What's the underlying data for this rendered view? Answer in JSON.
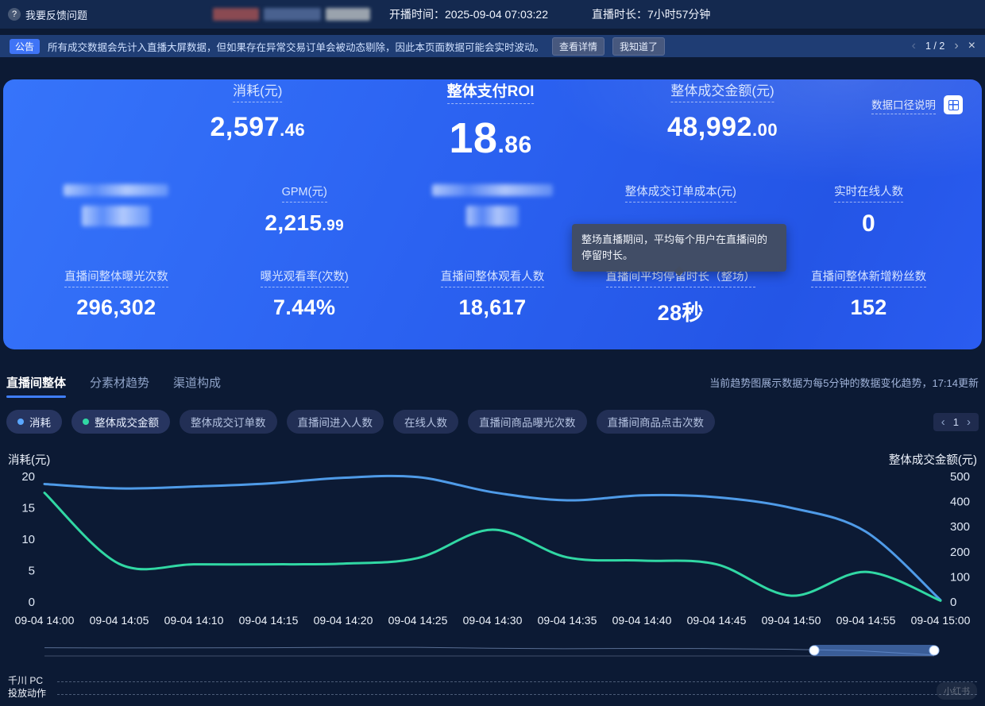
{
  "topbar": {
    "feedback_label": "我要反馈问题",
    "question_icon": "?",
    "start_time_label": "开播时间：",
    "start_time_value": "2025-09-04 07:03:22",
    "duration_label": "直播时长：",
    "duration_value": "7小时57分钟"
  },
  "announcement": {
    "badge": "公告",
    "message": "所有成交数据会先计入直播大屏数据，但如果存在异常交易订单会被动态剔除，因此本页面数据可能会实时波动。",
    "detail_button": "查看详情",
    "ack_button": "我知道了",
    "page_indicator": "1 / 2",
    "prev_icon": "‹",
    "next_icon": "›",
    "close_icon": "×"
  },
  "hero": {
    "caliber_link": "数据口径说明",
    "row1": [
      {
        "label": "消耗(元)",
        "int": "2,597",
        "dec": ".46"
      },
      {
        "label": "整体支付ROI",
        "int": "18",
        "dec": ".86"
      },
      {
        "label": "整体成交金额(元)",
        "int": "48,992",
        "dec": ".00"
      }
    ],
    "row2": {
      "gpm_label": "GPM(元)",
      "gpm_int": "2,215",
      "gpm_dec": ".99",
      "order_cost_label": "整体成交订单成本(元)",
      "online_label": "实时在线人数",
      "online_value": "0"
    },
    "tooltip_text": "整场直播期间，平均每个用户在直播间的停留时长。",
    "row3": [
      {
        "label": "直播间整体曝光次数",
        "value": "296,302"
      },
      {
        "label": "曝光观看率(次数)",
        "value": "7.44%"
      },
      {
        "label": "直播间整体观看人数",
        "value": "18,617"
      },
      {
        "label": "直播间平均停留时长（整场）",
        "value": "28秒"
      },
      {
        "label": "直播间整体新增粉丝数",
        "value": "152"
      }
    ]
  },
  "trend": {
    "tabs": [
      {
        "label": "直播间整体",
        "active": true
      },
      {
        "label": "分素材趋势",
        "active": false
      },
      {
        "label": "渠道构成",
        "active": false
      }
    ],
    "update_note": "当前趋势图展示数据为每5分钟的数据变化趋势，17:14更新",
    "pills": [
      {
        "label": "消耗",
        "dot": "#5aa7ff"
      },
      {
        "label": "整体成交金额",
        "dot": "#31d8a4"
      },
      {
        "label": "整体成交订单数"
      },
      {
        "label": "直播间进入人数"
      },
      {
        "label": "在线人数"
      },
      {
        "label": "直播间商品曝光次数"
      },
      {
        "label": "直播间商品点击次数"
      }
    ],
    "pager_page": "1",
    "prev_icon": "‹",
    "next_icon": "›"
  },
  "chart_data": {
    "type": "line",
    "x": [
      "09-04 14:00",
      "09-04 14:05",
      "09-04 14:10",
      "09-04 14:15",
      "09-04 14:20",
      "09-04 14:25",
      "09-04 14:30",
      "09-04 14:35",
      "09-04 14:40",
      "09-04 14:45",
      "09-04 14:50",
      "09-04 14:55",
      "09-04 15:00"
    ],
    "series": [
      {
        "name": "消耗(元)",
        "axis": "left",
        "color": "#4f9be8",
        "values": [
          18.8,
          18.1,
          18.4,
          18.9,
          19.8,
          19.9,
          17.5,
          16.2,
          17.0,
          16.7,
          15.0,
          11.2,
          0.3
        ]
      },
      {
        "name": "整体成交金额(元)",
        "axis": "right",
        "color": "#31d8a4",
        "values": [
          435,
          152,
          150,
          150,
          153,
          175,
          288,
          178,
          165,
          150,
          25,
          120,
          5
        ]
      }
    ],
    "left_axis": {
      "label": "消耗(元)",
      "min": 0,
      "max": 20,
      "ticks": [
        0,
        5,
        10,
        15,
        20
      ]
    },
    "right_axis": {
      "label": "整体成交金额(元)",
      "min": 0,
      "max": 500,
      "ticks": [
        0,
        100,
        200,
        300,
        400,
        500
      ]
    },
    "grid": false,
    "legend_position": "pills-above"
  },
  "footer": {
    "action_label_line1": "千川 PC",
    "action_label_line2": "投放动作",
    "watermark": "小红书"
  }
}
